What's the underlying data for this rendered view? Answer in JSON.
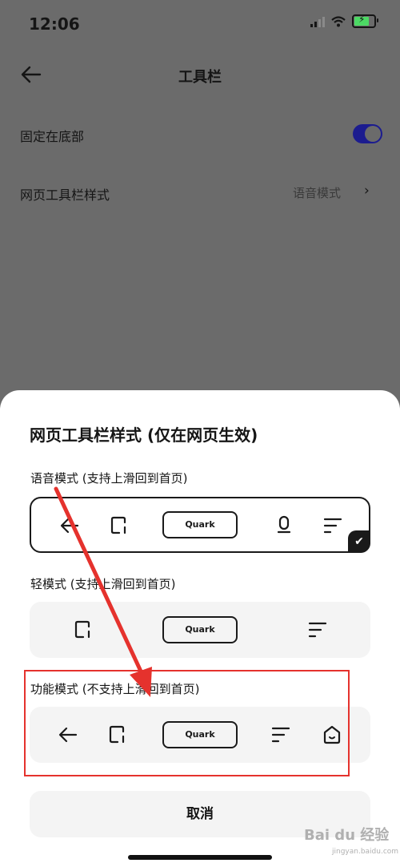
{
  "status_bar": {
    "time": "12:06"
  },
  "header": {
    "title": "工具栏"
  },
  "settings": {
    "pin_bottom": {
      "label": "固定在底部",
      "enabled": true
    },
    "toolbar_style": {
      "label": "网页工具栏样式",
      "value": "语音模式"
    }
  },
  "sheet": {
    "title": "网页工具栏样式 (仅在网页生效)",
    "options": [
      {
        "label": "语音模式 (支持上滑回到首页)",
        "selected": true,
        "quark": "Quark",
        "icons": [
          "back-arrow-icon",
          "tabs-icon",
          "microphone-icon",
          "menu-icon"
        ]
      },
      {
        "label": "轻模式 (支持上滑回到首页)",
        "selected": false,
        "quark": "Quark",
        "icons": [
          "tabs-icon",
          "menu-icon"
        ]
      },
      {
        "label": "功能模式 (不支持上滑回到首页)",
        "selected": false,
        "quark": "Quark",
        "icons": [
          "back-arrow-icon",
          "tabs-icon",
          "menu-icon",
          "home-icon"
        ]
      }
    ],
    "cancel": "取消"
  },
  "watermark": {
    "text": "Bai du 经验",
    "sub": "jingyan.baidu.com"
  },
  "colors": {
    "toggle_on": "#1c1c8f",
    "annotation_red": "#e5322d",
    "dim_overlay": "#6b6b6b"
  }
}
